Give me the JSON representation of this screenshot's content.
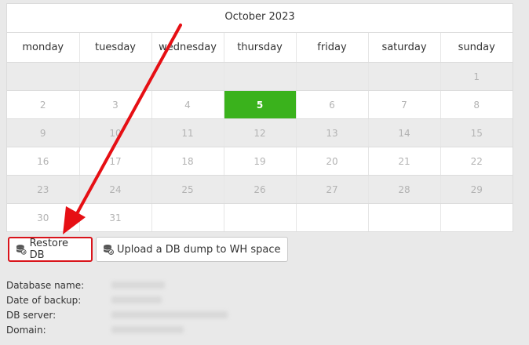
{
  "calendar": {
    "month_title": "October 2023",
    "weekdays": [
      "monday",
      "tuesday",
      "wednesday",
      "thursday",
      "friday",
      "saturday",
      "sunday"
    ],
    "weeks": [
      [
        "",
        "",
        "",
        "",
        "",
        "",
        "1"
      ],
      [
        "2",
        "3",
        "4",
        "5",
        "6",
        "7",
        "8"
      ],
      [
        "9",
        "10",
        "11",
        "12",
        "13",
        "14",
        "15"
      ],
      [
        "16",
        "17",
        "18",
        "19",
        "20",
        "21",
        "22"
      ],
      [
        "23",
        "24",
        "25",
        "26",
        "27",
        "28",
        "29"
      ],
      [
        "30",
        "31",
        "",
        "",
        "",
        "",
        ""
      ]
    ],
    "selected_day": "5",
    "selected_color": "#3ab21c"
  },
  "actions": {
    "restore_label": "Restore DB",
    "upload_label": "Upload a DB dump to WH space",
    "icon": "database-restore-icon"
  },
  "info": {
    "db_name_label": "Database name:",
    "backup_date_label": "Date of backup:",
    "db_server_label": "DB server:",
    "domain_label": "Domain:"
  },
  "annotation_color": "#e60f14"
}
